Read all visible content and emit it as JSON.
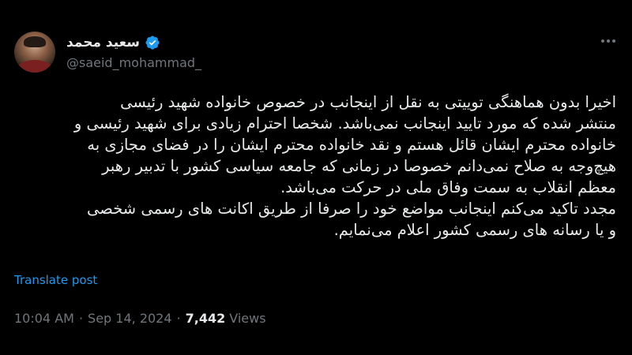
{
  "author": {
    "display_name": "سعید محمد",
    "handle": "@saeid_mohammad_",
    "verified": true
  },
  "post": {
    "lines": [
      "اخیرا بدون هماهنگی توییتی به نقل از اینجانب در خصوص خانواده شهید رئیسی",
      "منتشر شده که مورد تایید اینجانب نمی‌باشد. شخصا احترام زیادی برای شهید رئیسی و",
      "خانواده محترم ایشان قائل هستم و نقد خانواده محترم ایشان را در فضای مجازی به",
      "هیچ‌وجه به صلاح نمی‌دانم خصوصا در زمانی که جامعه سیاسی کشور با تدبیر رهبر",
      "معظم انقلاب به سمت وفاق ملی در حرکت می‌باشد.",
      "مجدد تاکید می‌کنم اینجانب مواضع خود را صرفا از طریق اکانت های رسمی شخصی",
      "و یا رسانه های رسمی کشور اعلام می‌نمایم."
    ],
    "translate_label": "Translate post"
  },
  "meta": {
    "time": "10:04 AM",
    "separator": "·",
    "date": "Sep 14, 2024",
    "views_count": "7,442",
    "views_label": "Views"
  },
  "colors": {
    "background": "#000000",
    "text": "#e7e9ea",
    "secondary": "#71767b",
    "accent": "#1d9bf0"
  },
  "icons": {
    "verified": "verified-badge-icon",
    "more": "more-horizontal-icon"
  }
}
